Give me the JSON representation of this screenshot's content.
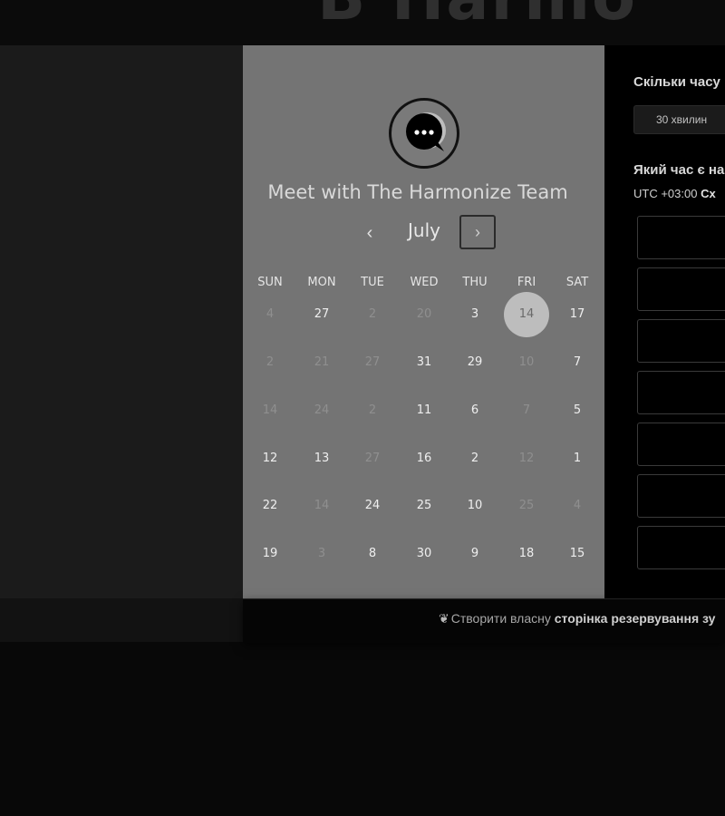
{
  "header": {
    "logo_text": "B Harmo"
  },
  "calendar": {
    "title": "Meet with The Harmonize Team",
    "month": "July",
    "prev_symbol": "‹",
    "next_symbol": "›",
    "weekdays": [
      "SUN",
      "MON",
      "TUE",
      "WED",
      "THU",
      "FRI",
      "SAT"
    ],
    "weeks": [
      [
        {
          "d": "4",
          "a": false
        },
        {
          "d": "27",
          "a": true
        },
        {
          "d": "2",
          "a": false
        },
        {
          "d": "20",
          "a": false
        },
        {
          "d": "3",
          "a": true
        },
        {
          "d": "14",
          "a": true,
          "sel": true
        },
        {
          "d": "17",
          "a": true
        }
      ],
      [
        {
          "d": "2",
          "a": false
        },
        {
          "d": "21",
          "a": false
        },
        {
          "d": "27",
          "a": false
        },
        {
          "d": "31",
          "a": true
        },
        {
          "d": "29",
          "a": true
        },
        {
          "d": "10",
          "a": false
        },
        {
          "d": "7",
          "a": true
        }
      ],
      [
        {
          "d": "14",
          "a": false
        },
        {
          "d": "24",
          "a": false
        },
        {
          "d": "2",
          "a": false
        },
        {
          "d": "11",
          "a": true
        },
        {
          "d": "6",
          "a": true
        },
        {
          "d": "7",
          "a": false
        },
        {
          "d": "5",
          "a": true
        }
      ],
      [
        {
          "d": "12",
          "a": true
        },
        {
          "d": "13",
          "a": true
        },
        {
          "d": "27",
          "a": false
        },
        {
          "d": "16",
          "a": true
        },
        {
          "d": "2",
          "a": true
        },
        {
          "d": "12",
          "a": false
        },
        {
          "d": "1",
          "a": true
        }
      ],
      [
        {
          "d": "22",
          "a": true
        },
        {
          "d": "14",
          "a": false
        },
        {
          "d": "24",
          "a": true
        },
        {
          "d": "25",
          "a": true
        },
        {
          "d": "10",
          "a": true
        },
        {
          "d": "25",
          "a": false
        },
        {
          "d": "4",
          "a": false
        }
      ],
      [
        {
          "d": "19",
          "a": true
        },
        {
          "d": "3",
          "a": false
        },
        {
          "d": "8",
          "a": true
        },
        {
          "d": "30",
          "a": true
        },
        {
          "d": "9",
          "a": true
        },
        {
          "d": "18",
          "a": true
        },
        {
          "d": "15",
          "a": true
        }
      ]
    ]
  },
  "scheduler": {
    "duration_heading": "Скільки часу",
    "duration_option": "30 хвилин",
    "time_heading": "Який час є на",
    "timezone_prefix": "UTC +03:00",
    "timezone_name": "Сх",
    "slot_count": 7
  },
  "footer": {
    "icon": "sprocket-icon",
    "link_prefix": "Створити власну",
    "link_bold": "сторінка резервування зу"
  },
  "colors": {
    "page_background": "#080808",
    "calendar_panel": "#747474",
    "selected_day": "#bdbdbd",
    "right_panel": "#000000"
  }
}
